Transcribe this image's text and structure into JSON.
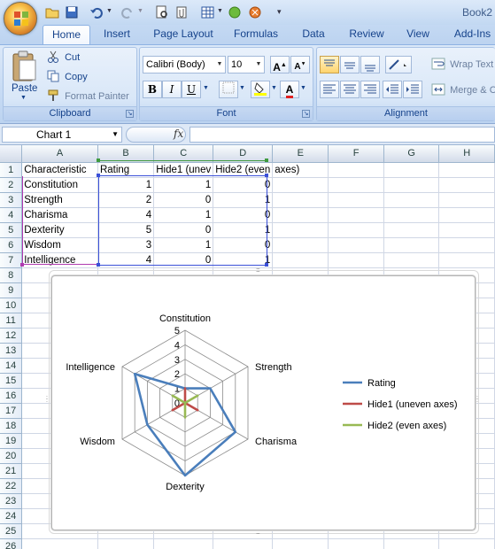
{
  "window": {
    "title": "Book2"
  },
  "qat": {
    "icons": [
      "save-icon",
      "undo-icon",
      "redo-icon",
      "print-preview-icon",
      "attach-icon",
      "table-icon",
      "green-circle-icon",
      "paint-icon",
      "customize-icon"
    ]
  },
  "tabs": [
    "Home",
    "Insert",
    "Page Layout",
    "Formulas",
    "Data",
    "Review",
    "View",
    "Add-Ins"
  ],
  "clipboard": {
    "paste": "Paste",
    "cut": "Cut",
    "copy": "Copy",
    "format_painter": "Format Painter",
    "label": "Clipboard"
  },
  "font": {
    "name": "Calibri (Body)",
    "size": "10",
    "label": "Font",
    "bold": "B",
    "italic": "I",
    "underline": "U"
  },
  "alignment": {
    "wrap_text": "Wrap Text",
    "merge": "Merge & C",
    "label": "Alignment"
  },
  "formula_bar": {
    "name_box": "Chart 1",
    "fx": "fx",
    "value": ""
  },
  "sheet": {
    "columns": [
      "A",
      "B",
      "C",
      "D",
      "E",
      "F",
      "G",
      "H"
    ],
    "rows": [
      "1",
      "2",
      "3",
      "4",
      "5",
      "6",
      "7",
      "8",
      "9",
      "10",
      "11",
      "12",
      "13",
      "14",
      "15",
      "16",
      "17",
      "18",
      "19",
      "20",
      "21",
      "22",
      "23",
      "24",
      "25",
      "26"
    ],
    "data": [
      [
        "Characteristic",
        "Rating",
        "Hide1 (uneven axes)",
        "Hide2 (even axes)"
      ],
      [
        "Constitution",
        "1",
        "1",
        "0"
      ],
      [
        "Strength",
        "2",
        "0",
        "1"
      ],
      [
        "Charisma",
        "4",
        "1",
        "0"
      ],
      [
        "Dexterity",
        "5",
        "0",
        "1"
      ],
      [
        "Wisdom",
        "3",
        "1",
        "0"
      ],
      [
        "Intelligence",
        "4",
        "0",
        "1"
      ]
    ],
    "header_display": [
      "Characteristic",
      "Rating",
      "Hide1 (unev",
      "Hide2 (even",
      "axes)"
    ]
  },
  "chart_data": {
    "type": "radar",
    "categories": [
      "Constitution",
      "Strength",
      "Charisma",
      "Dexterity",
      "Wisdom",
      "Intelligence"
    ],
    "series": [
      {
        "name": "Rating",
        "values": [
          1,
          2,
          4,
          5,
          3,
          4
        ],
        "color": "#4a7ebb"
      },
      {
        "name": "Hide1 (uneven axes)",
        "values": [
          1,
          0,
          1,
          0,
          1,
          0
        ],
        "color": "#be4b48"
      },
      {
        "name": "Hide2 (even axes)",
        "values": [
          0,
          1,
          0,
          1,
          0,
          1
        ],
        "color": "#98b954"
      }
    ],
    "rmax": 5,
    "ticks": [
      "0",
      "1",
      "2",
      "3",
      "4",
      "5"
    ],
    "legend_position": "right"
  }
}
